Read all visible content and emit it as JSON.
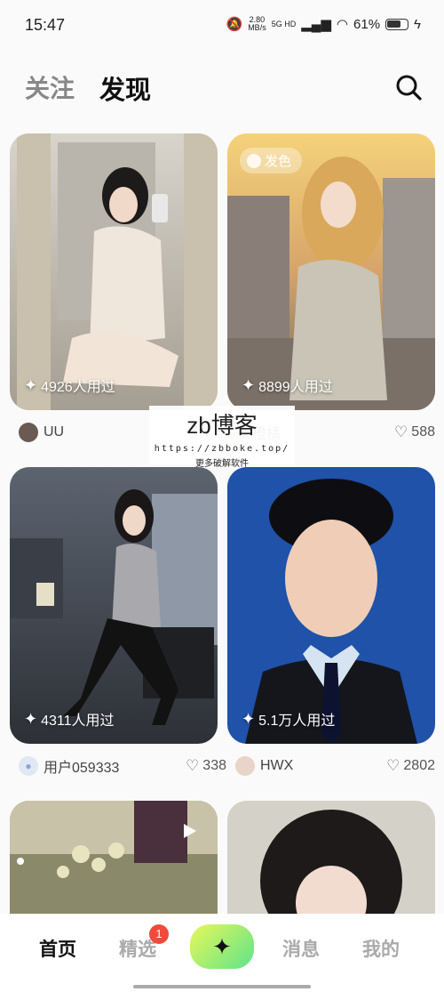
{
  "status": {
    "time": "15:47",
    "speed_value": "2.80",
    "speed_unit": "MB/s",
    "network": "5G HD",
    "battery": "61%"
  },
  "header": {
    "tab_follow": "关注",
    "tab_discover": "发现",
    "search_icon": "search-icon"
  },
  "feed": [
    {
      "used": "4926人用过",
      "user": "UU",
      "likes": "",
      "tag": ""
    },
    {
      "used": "8899人用过",
      "user": "橙橘",
      "likes": "588",
      "tag": "发色"
    },
    {
      "used": "4311人用过",
      "user": "用户059333",
      "likes": "338",
      "tag": ""
    },
    {
      "used": "5.1万人用过",
      "user": "HWX",
      "likes": "2802",
      "tag": ""
    }
  ],
  "watermark": {
    "title": "zb博客",
    "url": "https://zbboke.top/",
    "sub": "更多破解软件"
  },
  "bottom_nav": {
    "home": "首页",
    "featured": "精选",
    "featured_badge": "1",
    "messages": "消息",
    "mine": "我的",
    "create_icon": "sparkle-icon"
  },
  "colors": {
    "accent_gradient_start": "#e8f85a",
    "accent_gradient_end": "#5ee38a",
    "badge_red": "#f04a3a"
  }
}
